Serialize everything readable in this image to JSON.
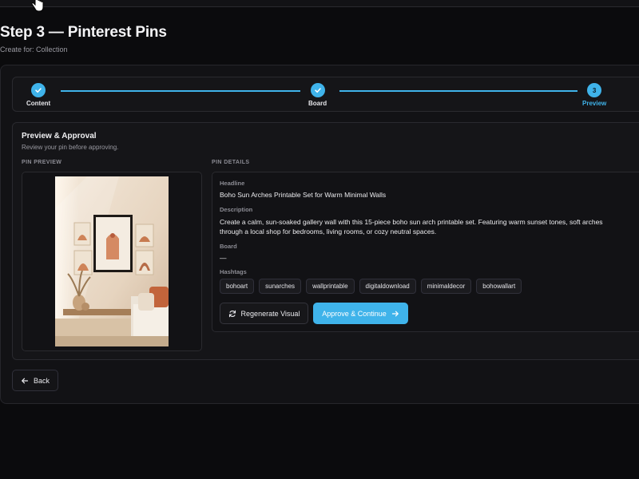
{
  "page": {
    "title": "Step 3 — Pinterest Pins",
    "subtitle": "Create for: Collection"
  },
  "stepper": {
    "steps": [
      {
        "label": "Content",
        "state": "done"
      },
      {
        "label": "Board",
        "state": "done"
      },
      {
        "label": "Preview",
        "state": "active",
        "number": "3"
      }
    ]
  },
  "preview": {
    "title": "Preview & Approval",
    "subtitle": "Review your pin before approving.",
    "pin_preview_label": "PIN PREVIEW",
    "pin_details_label": "PIN DETAILS"
  },
  "details": {
    "headline_label": "Headline",
    "headline": "Boho Sun Arches Printable Set for Warm Minimal Walls",
    "description_label": "Description",
    "description_line1": "Create a calm, sun-soaked gallery wall with this 15-piece boho sun arch printable set. Featuring warm sunset tones, soft arches",
    "description_line2": "through a local shop for bedrooms, living rooms, or cozy neutral spaces.",
    "board_label": "Board",
    "board": "—",
    "hashtags_label": "Hashtags",
    "hashtags": [
      "bohoart",
      "sunarches",
      "wallprintable",
      "digitaldownload",
      "minimaldecor",
      "bohowallart"
    ]
  },
  "actions": {
    "regenerate_label": "Regenerate Visual",
    "approve_label": "Approve & Continue",
    "back_label": "Back"
  },
  "colors": {
    "accent": "#3fb3ea",
    "background": "#0b0b0d",
    "card": "#151518"
  },
  "icons": {
    "check": "check-icon",
    "refresh": "refresh-icon",
    "arrow_right": "arrow-right-icon",
    "arrow_left": "arrow-left-icon",
    "cursor": "hand-cursor-icon"
  }
}
